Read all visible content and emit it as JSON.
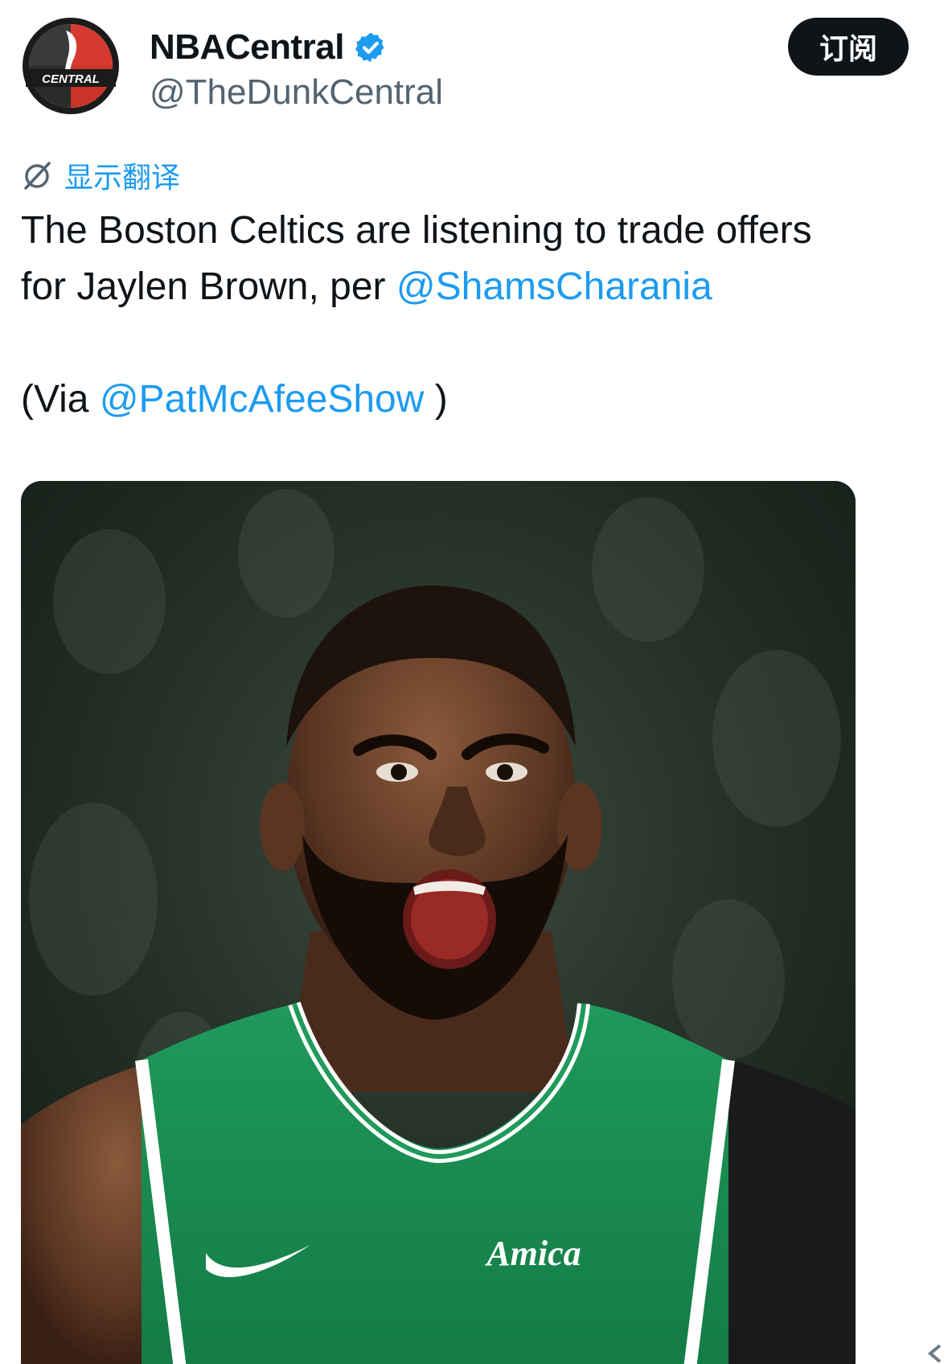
{
  "author": {
    "display_name": "NBACentral",
    "handle": "@TheDunkCentral",
    "avatar_text": "CENTRAL",
    "verified": true
  },
  "subscribe_label": "订阅",
  "translate_label": "显示翻译",
  "tweet": {
    "line1": "The Boston Celtics are listening to trade offers",
    "line2_prefix": "for Jaylen Brown, per ",
    "mention1": "@ShamsCharania",
    "line3_prefix": "(Via ",
    "mention2": "@PatMcAfeeShow",
    "line3_suffix": " )"
  },
  "media": {
    "jersey_text": "Amica"
  },
  "colors": {
    "accent": "#1d9bf0",
    "text": "#0f1419",
    "secondary_text": "#536471",
    "button_bg": "#0f1419"
  }
}
